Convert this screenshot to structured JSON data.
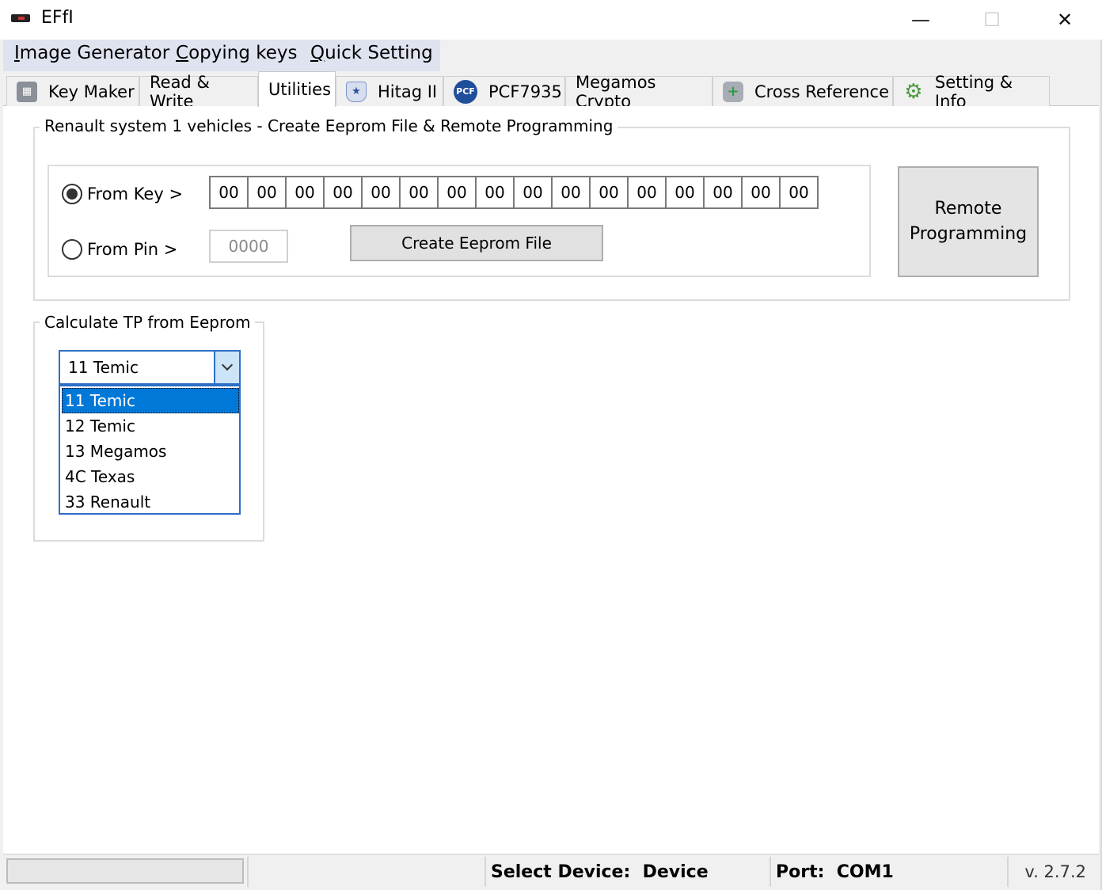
{
  "window": {
    "title": "EFfI"
  },
  "menu": [
    {
      "label": "Image Generator",
      "accel": "I",
      "rest": "mage Generator"
    },
    {
      "label": "Copying keys",
      "accel": "C",
      "rest": "opying keys"
    },
    {
      "label": "Quick Setting",
      "accel": "Q",
      "rest": "uick Setting"
    }
  ],
  "tabs": [
    {
      "label": "Key Maker",
      "icon": "calculator-icon"
    },
    {
      "label": "Read & Write",
      "icon": ""
    },
    {
      "label": "Utilities",
      "icon": "",
      "active": true
    },
    {
      "label": "Hitag II",
      "icon": "philips-shield-icon"
    },
    {
      "label": "PCF7935",
      "icon": "pcf-badge-icon"
    },
    {
      "label": "Megamos Crypto",
      "icon": ""
    },
    {
      "label": "Cross Reference",
      "icon": "database-add-icon"
    },
    {
      "label": "Setting & Info",
      "icon": "gear-icon"
    }
  ],
  "renault_group": {
    "title": "Renault system 1 vehicles - Create Eeprom File & Remote Programming",
    "from_key_label": "From Key  >",
    "from_pin_label": "From Pin  >",
    "selected_source": "From Key",
    "hex_bytes": [
      "00",
      "00",
      "00",
      "00",
      "00",
      "00",
      "00",
      "00",
      "00",
      "00",
      "00",
      "00",
      "00",
      "00",
      "00",
      "00"
    ],
    "pin_value": "0000",
    "create_button": "Create Eeprom File",
    "remote_button_line1": "Remote",
    "remote_button_line2": "Programming"
  },
  "tp_group": {
    "title": "Calculate TP from Eeprom",
    "combo_value": "11 Temic",
    "options": [
      "11 Temic",
      "12 Temic",
      "13 Megamos",
      "4C Texas",
      "33 Renault"
    ],
    "selected_index": 0
  },
  "status": {
    "device_label": "Select Device:",
    "device_value": "Device",
    "port_label": "Port:",
    "port_value": "COM1",
    "version": "v. 2.7.2"
  },
  "colors": {
    "accent": "#0078d7",
    "menubar": "#dfe3f0",
    "combo_border": "#2d6fc5"
  }
}
